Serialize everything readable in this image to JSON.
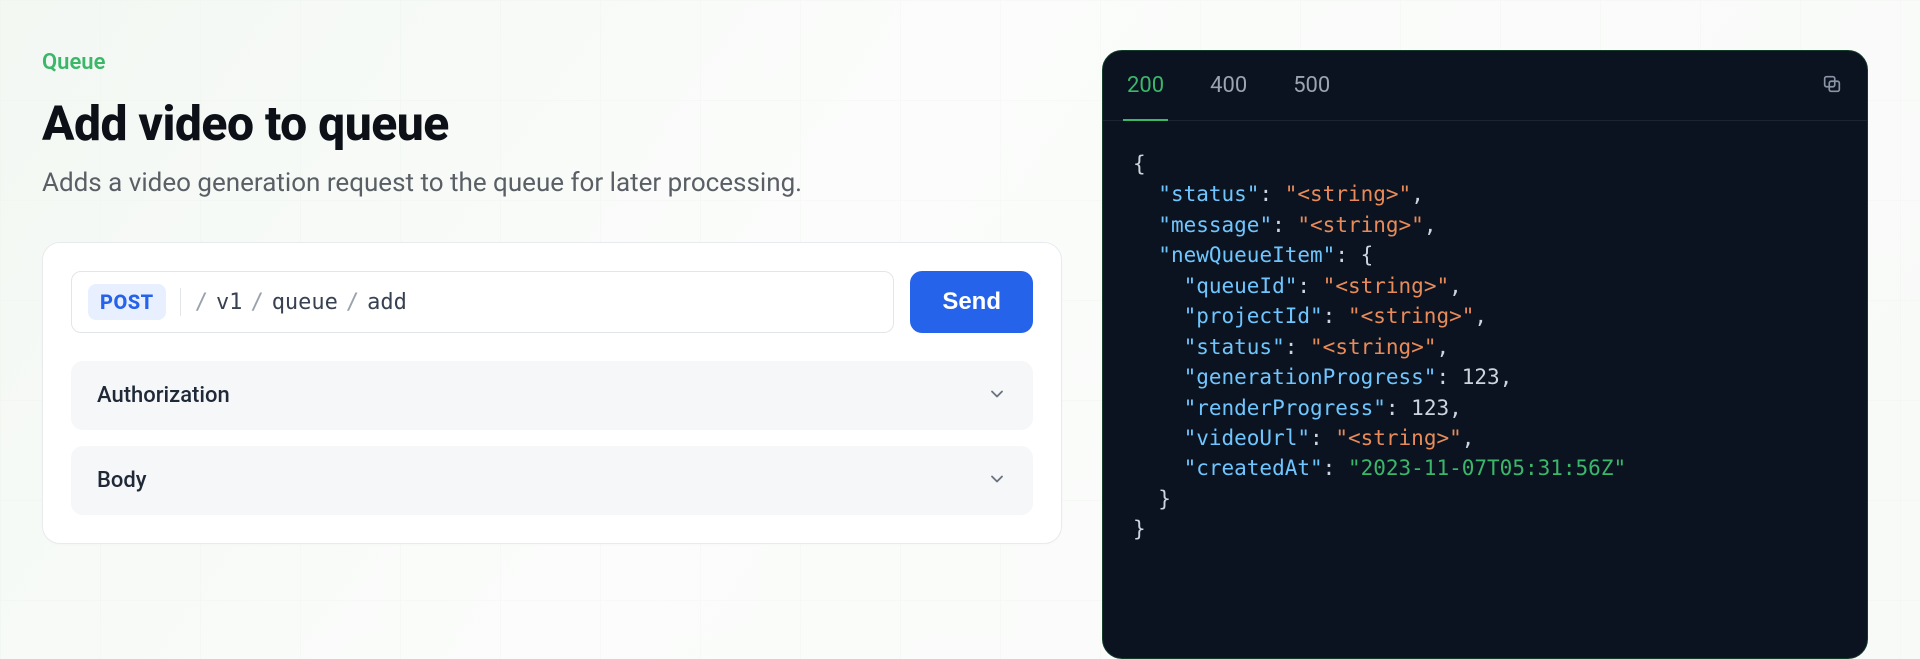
{
  "header": {
    "eyebrow": "Queue",
    "title": "Add video to queue",
    "subtitle": "Adds a video generation request to the queue for later processing."
  },
  "request": {
    "method": "POST",
    "path_segments": [
      "v1",
      "queue",
      "add"
    ],
    "send_label": "Send",
    "sections": {
      "authorization_label": "Authorization",
      "body_label": "Body"
    }
  },
  "response": {
    "tabs": [
      "200",
      "400",
      "500"
    ],
    "active_tab_index": 0,
    "json_tokens": [
      {
        "t": "punc",
        "v": "{"
      },
      {
        "t": "nl",
        "v": ""
      },
      {
        "t": "indent",
        "v": "  "
      },
      {
        "t": "key",
        "v": "\"status\""
      },
      {
        "t": "punc",
        "v": ": "
      },
      {
        "t": "str",
        "v": "\"<string>\""
      },
      {
        "t": "punc",
        "v": ","
      },
      {
        "t": "nl",
        "v": ""
      },
      {
        "t": "indent",
        "v": "  "
      },
      {
        "t": "key",
        "v": "\"message\""
      },
      {
        "t": "punc",
        "v": ": "
      },
      {
        "t": "str",
        "v": "\"<string>\""
      },
      {
        "t": "punc",
        "v": ","
      },
      {
        "t": "nl",
        "v": ""
      },
      {
        "t": "indent",
        "v": "  "
      },
      {
        "t": "key",
        "v": "\"newQueueItem\""
      },
      {
        "t": "punc",
        "v": ": {"
      },
      {
        "t": "nl",
        "v": ""
      },
      {
        "t": "indent",
        "v": "    "
      },
      {
        "t": "key",
        "v": "\"queueId\""
      },
      {
        "t": "punc",
        "v": ": "
      },
      {
        "t": "str",
        "v": "\"<string>\""
      },
      {
        "t": "punc",
        "v": ","
      },
      {
        "t": "nl",
        "v": ""
      },
      {
        "t": "indent",
        "v": "    "
      },
      {
        "t": "key",
        "v": "\"projectId\""
      },
      {
        "t": "punc",
        "v": ": "
      },
      {
        "t": "str",
        "v": "\"<string>\""
      },
      {
        "t": "punc",
        "v": ","
      },
      {
        "t": "nl",
        "v": ""
      },
      {
        "t": "indent",
        "v": "    "
      },
      {
        "t": "key",
        "v": "\"status\""
      },
      {
        "t": "punc",
        "v": ": "
      },
      {
        "t": "str",
        "v": "\"<string>\""
      },
      {
        "t": "punc",
        "v": ","
      },
      {
        "t": "nl",
        "v": ""
      },
      {
        "t": "indent",
        "v": "    "
      },
      {
        "t": "key",
        "v": "\"generationProgress\""
      },
      {
        "t": "punc",
        "v": ": "
      },
      {
        "t": "num",
        "v": "123"
      },
      {
        "t": "punc",
        "v": ","
      },
      {
        "t": "nl",
        "v": ""
      },
      {
        "t": "indent",
        "v": "    "
      },
      {
        "t": "key",
        "v": "\"renderProgress\""
      },
      {
        "t": "punc",
        "v": ": "
      },
      {
        "t": "num",
        "v": "123"
      },
      {
        "t": "punc",
        "v": ","
      },
      {
        "t": "nl",
        "v": ""
      },
      {
        "t": "indent",
        "v": "    "
      },
      {
        "t": "key",
        "v": "\"videoUrl\""
      },
      {
        "t": "punc",
        "v": ": "
      },
      {
        "t": "str",
        "v": "\"<string>\""
      },
      {
        "t": "punc",
        "v": ","
      },
      {
        "t": "nl",
        "v": ""
      },
      {
        "t": "indent",
        "v": "    "
      },
      {
        "t": "key",
        "v": "\"createdAt\""
      },
      {
        "t": "punc",
        "v": ": "
      },
      {
        "t": "date",
        "v": "\"2023-11-07T05:31:56Z\""
      },
      {
        "t": "nl",
        "v": ""
      },
      {
        "t": "indent",
        "v": "  "
      },
      {
        "t": "punc",
        "v": "}"
      },
      {
        "t": "nl",
        "v": ""
      },
      {
        "t": "punc",
        "v": "}"
      }
    ]
  }
}
